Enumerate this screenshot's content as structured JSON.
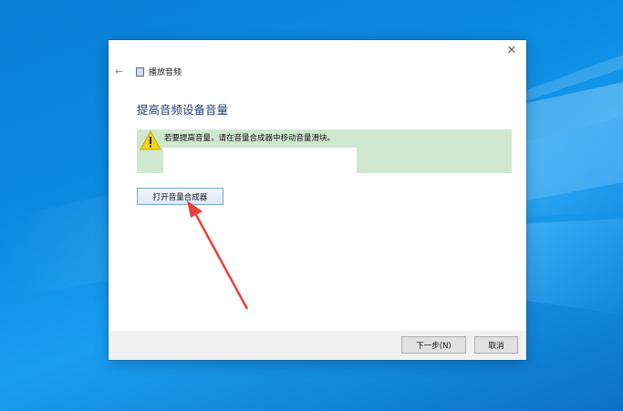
{
  "dialog": {
    "nav_title": "播放音频",
    "page_title": "提高音频设备音量",
    "warning_text": "若要提高音量，请在音量合成器中移动音量滑块。",
    "mixer_button_label": "打开音量合成器",
    "next_button_label": "下一步(N)",
    "cancel_button_label": "取消",
    "close_glyph": "✕",
    "back_glyph": "←"
  },
  "icons": {
    "close": "close-icon",
    "back": "back-arrow-icon",
    "app": "audio-troubleshooter-icon",
    "warning": "warning-icon"
  },
  "colors": {
    "highlight": "#cfe8cf",
    "title_blue": "#1f3d7a",
    "annotation_red": "#e8403a",
    "warning_yellow": "#f2d21b"
  }
}
